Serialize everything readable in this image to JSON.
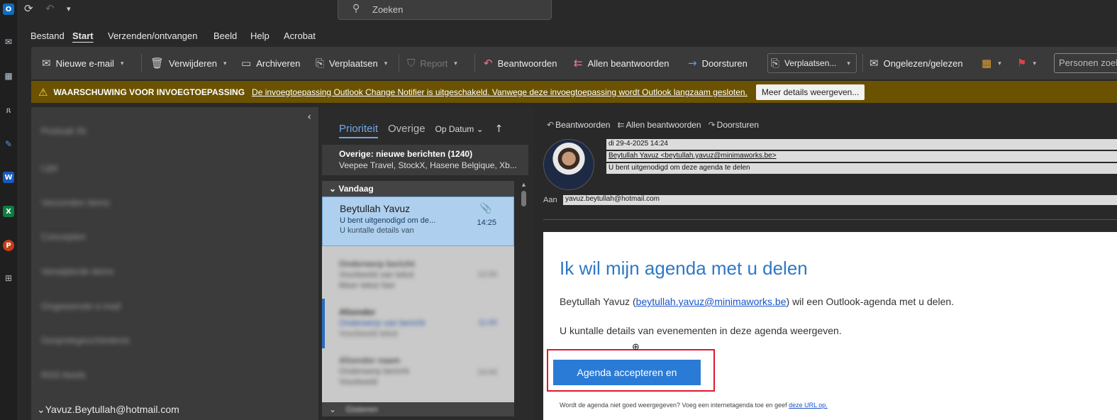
{
  "titlebar": {
    "search_placeholder": "Zoeken"
  },
  "menu": [
    "Bestand",
    "Start",
    "Verzenden/ontvangen",
    "Beeld",
    "Help",
    "Acrobat"
  ],
  "ribbon": {
    "new_email": "Nieuwe e-mail",
    "delete": "Verwijderen",
    "archive": "Archiveren",
    "move": "Verplaatsen",
    "report": "Report",
    "reply": "Beantwoorden",
    "reply_all": "Allen beantwoorden",
    "forward": "Doorsturen",
    "move_to": "Verplaatsen...",
    "unread_read": "Ongelezen/gelezen",
    "people_search": "Personen zoeken"
  },
  "warning": {
    "title": "WAARSCHUWING VOOR INVOEGTOEPASSING",
    "message": "De invoegtoepassing Outlook Change Notifier is uitgeschakeld. Vanwege deze invoegtoepassing wordt Outlook langzaam gesloten.",
    "button": "Meer details weergeven..."
  },
  "folders": {
    "blurred_items": [
      "Postvak IN",
      "Lijst",
      "Verzonden items",
      "Concepten",
      "Verwijderde items",
      "Ongewenste e-mail",
      "Gesprekgeschiedenis",
      "RSS-feeds"
    ],
    "account": "Yavuz.Beytullah@hotmail.com"
  },
  "message_list": {
    "tab_priority": "Prioriteit",
    "tab_other": "Overige",
    "sort": "Op Datum",
    "other_title": "Overige: nieuwe berichten (1240)",
    "other_senders": "Veepee Travel, StockX, Hasene Belgique, Xb...",
    "group_today": "Vandaag",
    "selected": {
      "from": "Beytullah Yavuz",
      "subject": "U bent uitgenodigd om de...",
      "preview": "U kuntalle details van",
      "time": "14:25"
    }
  },
  "reading": {
    "reply": "Beantwoorden",
    "reply_all": "Allen beantwoorden",
    "forward": "Doorsturen",
    "date": "di 29-4-2025 14:24",
    "from": "Beytullah Yavuz <beytullah.yavuz@minimaworks.be>",
    "subject": "U bent uitgenodigd om deze agenda te delen",
    "to_label": "Aan",
    "to": "yavuz.beytullah@hotmail.com",
    "heading": "Ik wil mijn agenda met u delen",
    "p1_prefix": "Beytullah Yavuz (",
    "p1_link": "beytullah.yavuz@minimaworks.be",
    "p1_suffix": ") wil een Outlook-agenda met u delen.",
    "p2": "U kuntalle details van evenementen in deze agenda weergeven.",
    "accept_button": "Agenda accepteren en",
    "footer_prefix": "Wordt de agenda niet goed weergegeven? Voeg een internetagenda toe en geef ",
    "footer_link": "deze URL op."
  }
}
